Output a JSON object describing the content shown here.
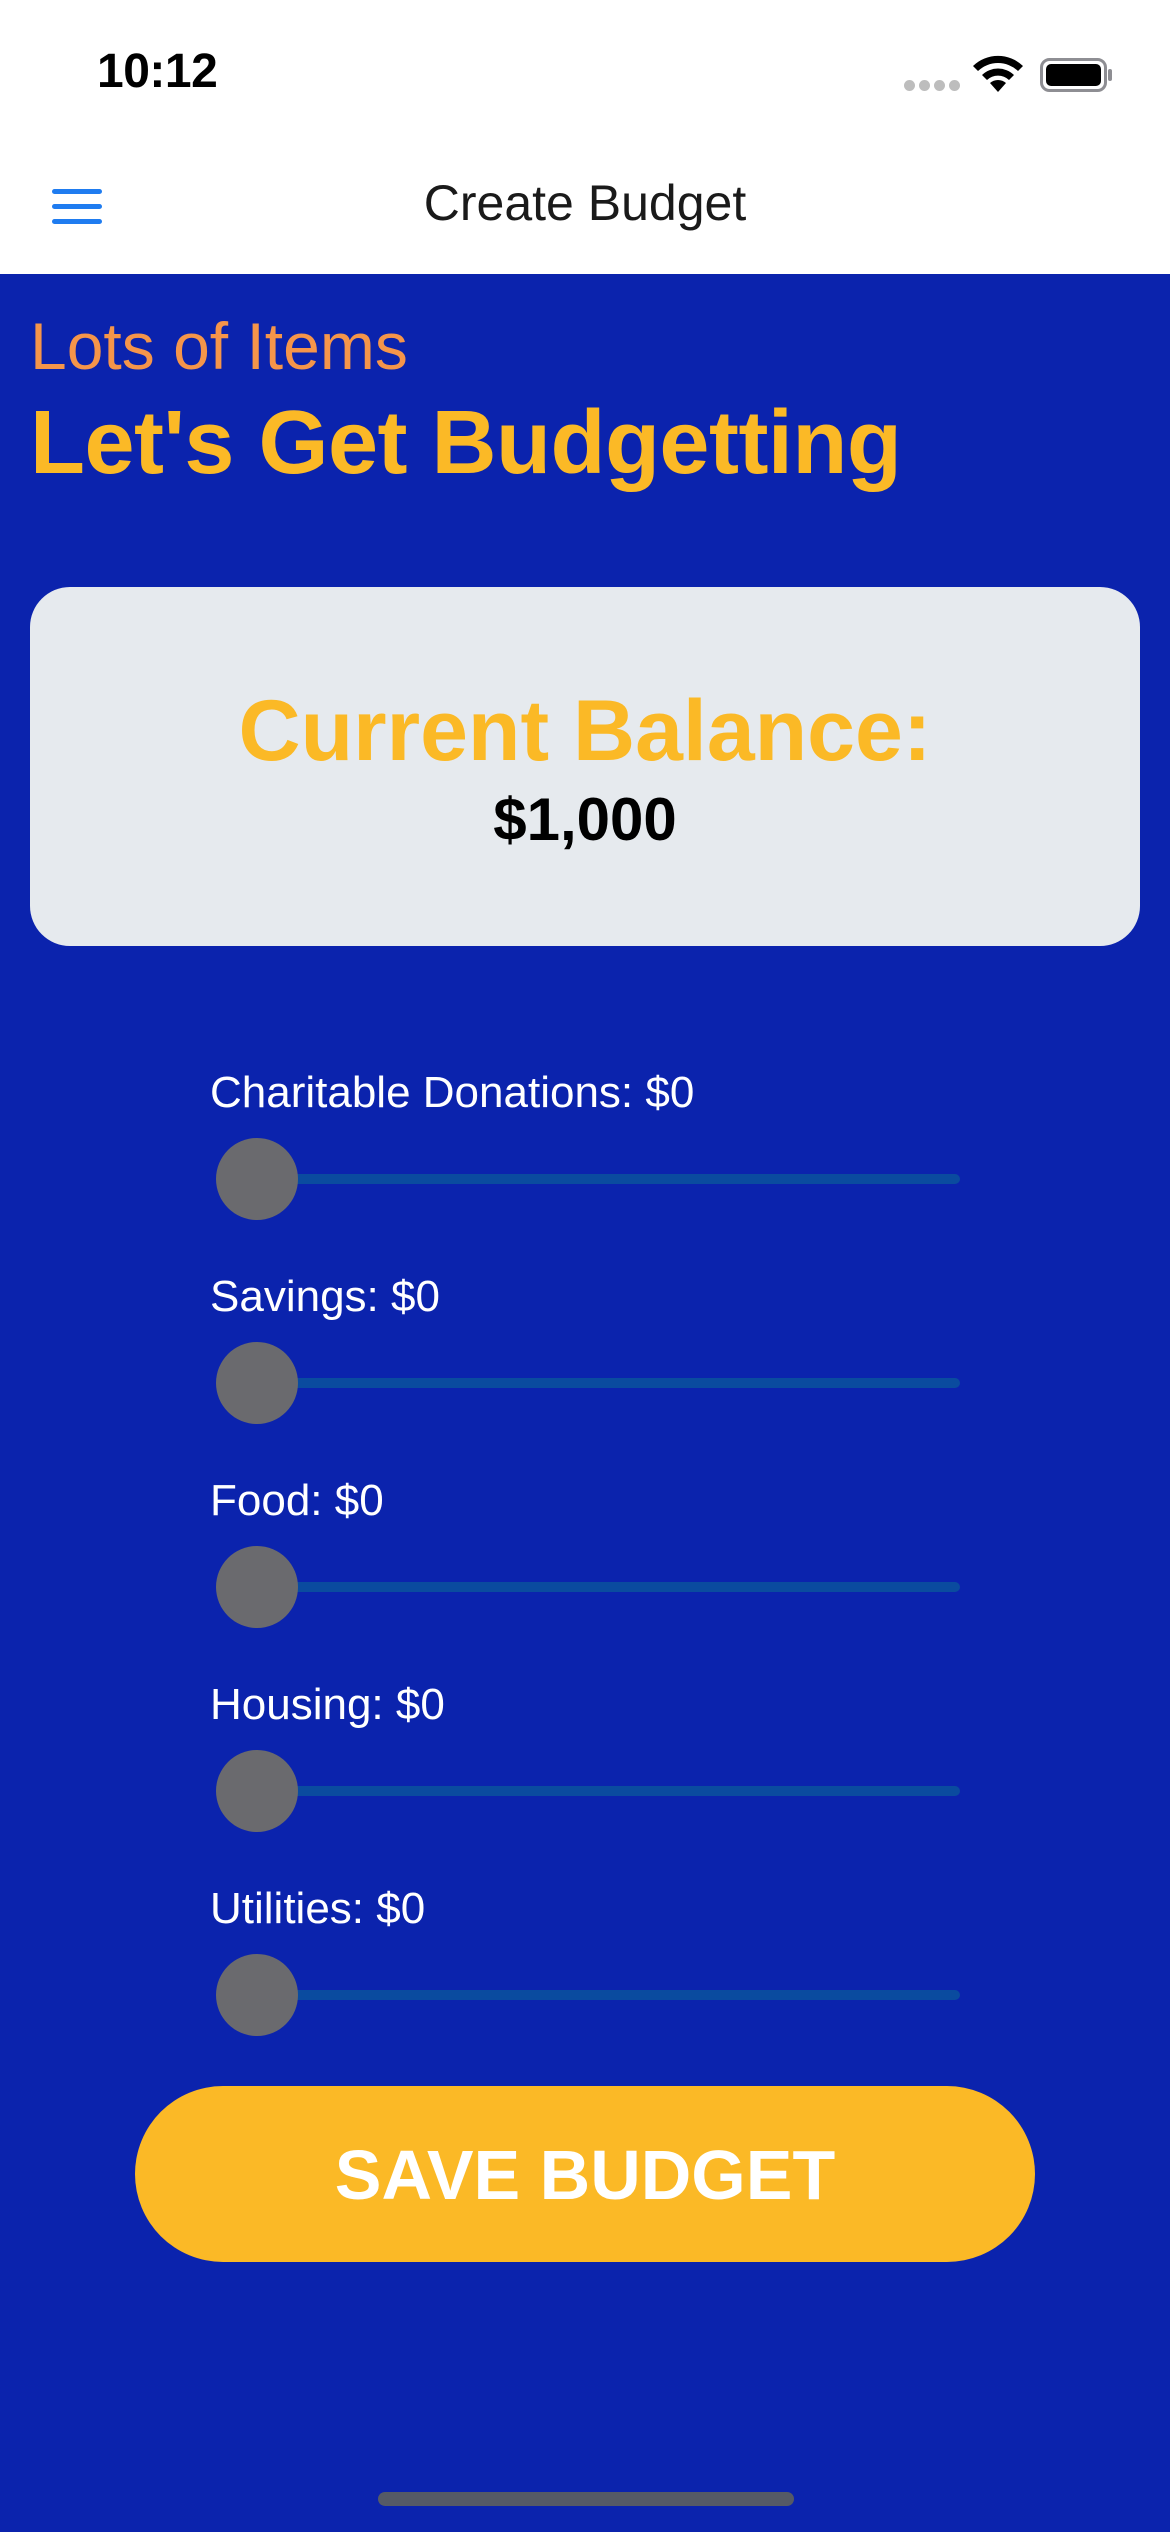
{
  "status_bar": {
    "time": "10:12",
    "icons": [
      "signal-icon",
      "wifi-icon",
      "battery-icon"
    ]
  },
  "nav": {
    "title": "Create Budget",
    "menu_icon": "menu-icon",
    "accent_color": "#1f7cf0"
  },
  "header": {
    "subtitle": "Lots of Items",
    "title": "Let's Get Budgetting"
  },
  "balance": {
    "label": "Current Balance:",
    "value": "$1,000"
  },
  "sliders": [
    {
      "label": "Charitable Donations: $0",
      "value": 0
    },
    {
      "label": "Savings: $0",
      "value": 0
    },
    {
      "label": "Food: $0",
      "value": 0
    },
    {
      "label": "Housing: $0",
      "value": 0
    },
    {
      "label": "Utilities: $0",
      "value": 0
    }
  ],
  "actions": {
    "save_label": "SAVE BUDGET"
  },
  "colors": {
    "background": "#0b23ad",
    "accent_yellow": "#fbb926",
    "accent_orange": "#f5954a",
    "card": "#e6eaee",
    "slider_track": "#0a4b9f",
    "slider_thumb": "#6a6a6e"
  }
}
